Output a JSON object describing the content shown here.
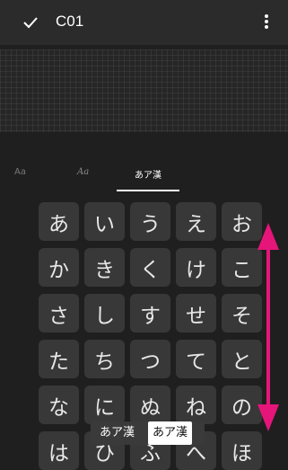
{
  "topbar": {
    "title": "C01",
    "confirm_icon": "check-icon",
    "menu_icon": "more-vert-icon"
  },
  "tabs": [
    {
      "label": "Aa",
      "style": "outline"
    },
    {
      "label": "Aa",
      "style": "script"
    },
    {
      "label": "あア漢",
      "active": true
    }
  ],
  "keys": [
    [
      "あ",
      "い",
      "う",
      "え",
      "お"
    ],
    [
      "か",
      "き",
      "く",
      "け",
      "こ"
    ],
    [
      "さ",
      "し",
      "す",
      "せ",
      "そ"
    ],
    [
      "た",
      "ち",
      "つ",
      "て",
      "と"
    ],
    [
      "な",
      "に",
      "ぬ",
      "ね",
      "の"
    ],
    [
      "は",
      "ひ",
      "ふ",
      "へ",
      "ほ"
    ]
  ],
  "popup": {
    "option_1": "あア漢",
    "option_2": "あア漢"
  },
  "scroll_arrow": {
    "color": "#e6157a",
    "icon": "double-arrow-vertical-icon"
  }
}
